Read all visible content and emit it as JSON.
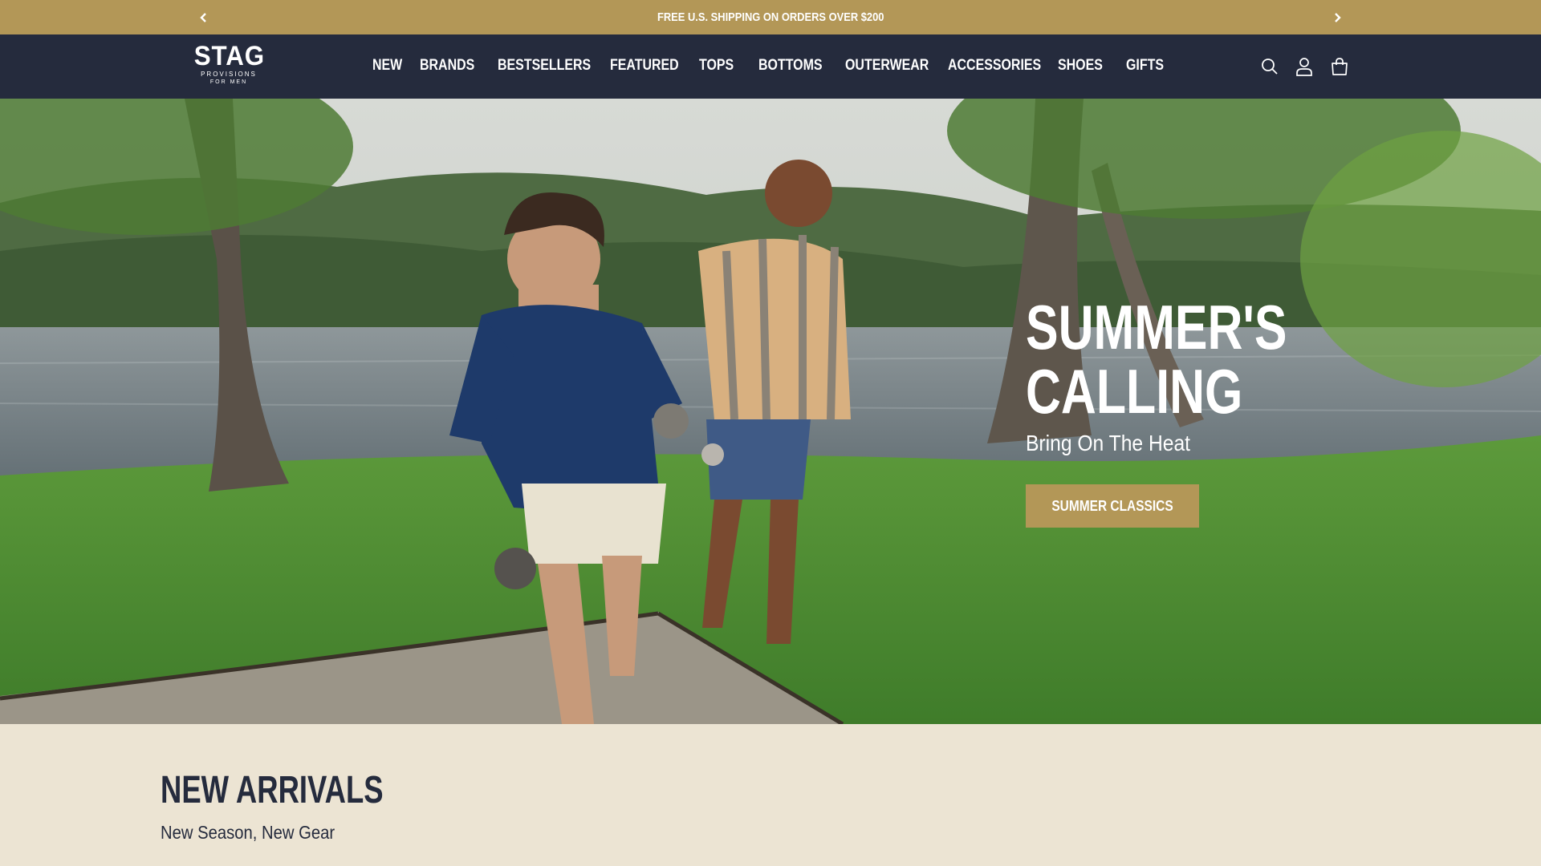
{
  "announcement": {
    "message": "FREE U.S. SHIPPING ON ORDERS OVER $200",
    "prev_icon": "chevron-left-icon",
    "next_icon": "chevron-right-icon"
  },
  "header": {
    "logo": {
      "wordmark": "STAG",
      "line2": "PROVISIONS",
      "line3": "FOR MEN"
    },
    "nav": [
      "NEW",
      "BRANDS",
      "BESTSELLERS",
      "FEATURED",
      "TOPS",
      "BOTTOMS",
      "OUTERWEAR",
      "ACCESSORIES",
      "SHOES",
      "GIFTS"
    ],
    "icons": [
      "search-icon",
      "account-icon",
      "cart-icon"
    ]
  },
  "hero": {
    "title_line1": "SUMMER'S",
    "title_line2": "CALLING",
    "subtitle": "Bring On The Heat",
    "button_label": "SUMMER CLASSICS"
  },
  "new_arrivals": {
    "title": "NEW ARRIVALS",
    "subtitle": "New Season, New Gear"
  },
  "colors": {
    "accent_gold": "#b39757",
    "navy": "#252b3d",
    "cream": "#ece4d3"
  }
}
